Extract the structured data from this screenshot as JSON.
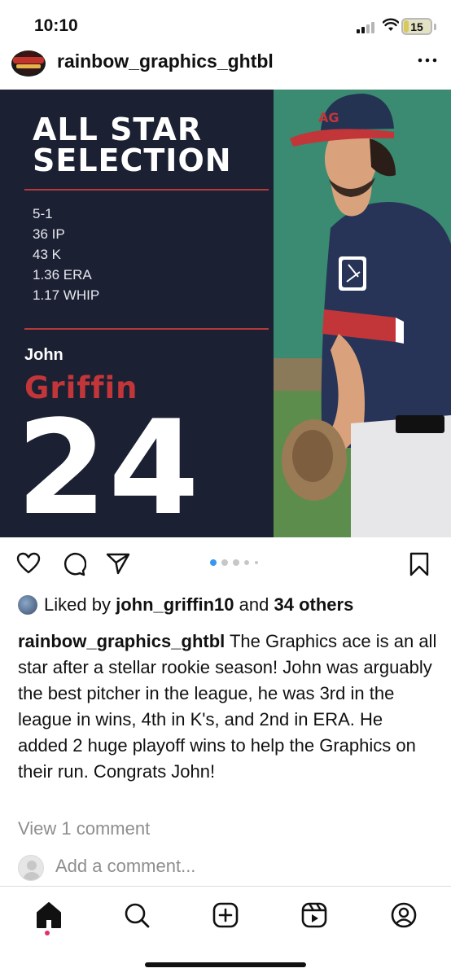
{
  "status_bar": {
    "time": "10:10",
    "battery_level": "15",
    "colors": {
      "battery": "#d9c85a"
    }
  },
  "post": {
    "username": "rainbow_graphics_ghtbl",
    "more_icon": "more-horizontal-icon"
  },
  "graphic": {
    "headline_line1": "ALL STAR",
    "headline_line2": "SELECTION",
    "stats": [
      "5-1",
      "36 IP",
      "43 K",
      "1.36 ERA",
      "1.17 WHIP"
    ],
    "first_name": "John",
    "last_name": "Griffin",
    "number": "24",
    "colors": {
      "panel": "#1b2033",
      "accent": "#c2363a"
    }
  },
  "actions": {
    "icons": [
      "heart-icon",
      "comment-icon",
      "share-icon",
      "bookmark-icon"
    ],
    "carousel": {
      "count": 5,
      "active": 0
    }
  },
  "likes": {
    "prefix": "Liked by",
    "user": "john_griffin10",
    "conjunction": "and",
    "others": "34 others"
  },
  "caption": {
    "username": "rainbow_graphics_ghtbl",
    "text": "The Graphics ace is an all star after a stellar rookie season! John was arguably the best pitcher in the league, he was 3rd in the league in wins, 4th in K's, and 2nd in ERA. He added 2 huge playoff wins to help the Graphics on their run. Congrats John!"
  },
  "comments": {
    "view_label": "View 1 comment",
    "placeholder": "Add a comment..."
  },
  "bottom_nav": {
    "items": [
      "home-icon",
      "search-icon",
      "new-post-icon",
      "reels-icon",
      "profile-icon"
    ],
    "active": "home-icon"
  }
}
